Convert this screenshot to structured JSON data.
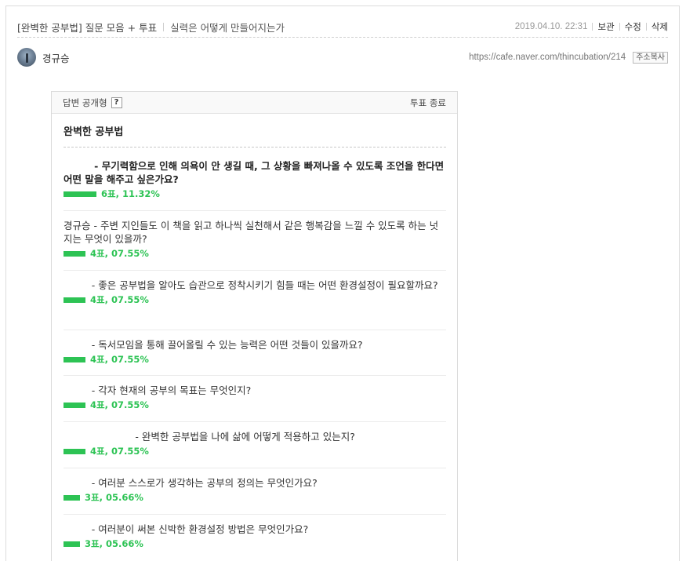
{
  "post": {
    "menu": "[완벽한 공부법] 질문 모음 + 투표",
    "title": "실력은 어떻게 만들어지는가",
    "date": "2019.04.10. 22:31",
    "actions": {
      "save": "보관",
      "edit": "수정",
      "delete": "삭제"
    },
    "author": "경규승",
    "url": "https://cafe.naver.com/thincubation/214",
    "copy_label": "주소복사"
  },
  "vote": {
    "header_left": "답변 공개형",
    "help_label": "?",
    "header_right": "투표 종료",
    "title": "완벽한 공부법",
    "colors": {
      "bar": "#2dc354",
      "count": "#2dc354"
    },
    "items": [
      {
        "text": "         - 무기력함으로 인해 의욕이 안 생길 때, 그 상황을 빠져나올 수 있도록 조언을 한다면 어떤 말을 해주고 싶은가요?",
        "count": "6표, 11.32%",
        "share": 0.1132
      },
      {
        "text": "경규승 - 주변 지인들도 이 책을 읽고 하나씩 실천해서 같은 행복감을 느낄 수 있도록 하는 넛지는 무엇이 있을까?",
        "count": "4표, 07.55%",
        "share": 0.0755
      },
      {
        "text": "         - 좋은 공부법을 알아도 습관으로 정착시키기 힘들 때는 어떤 환경설정이 필요할까요?",
        "count": "4표, 07.55%",
        "share": 0.0755
      },
      {
        "text": "         - 독서모임을 통해 끌어올릴 수 있는 능력은 어떤 것들이 있을까요?",
        "count": "4표, 07.55%",
        "share": 0.0755
      },
      {
        "text": "         - 각자 현재의 공부의 목표는 무엇인지?",
        "count": "4표, 07.55%",
        "share": 0.0755
      },
      {
        "text": "                       - 완벽한 공부법을 나에 삶에 어떻게 적용하고 있는지?",
        "count": "4표, 07.55%",
        "share": 0.0755
      },
      {
        "text": "         - 여러분 스스로가 생각하는 공부의 정의는 무엇인가요?",
        "count": "3표, 05.66%",
        "share": 0.0566
      },
      {
        "text": "         - 여러분이 써본 신박한 환경설정 방법은 무엇인가요?",
        "count": "3표, 05.66%",
        "share": 0.0566
      }
    ]
  }
}
